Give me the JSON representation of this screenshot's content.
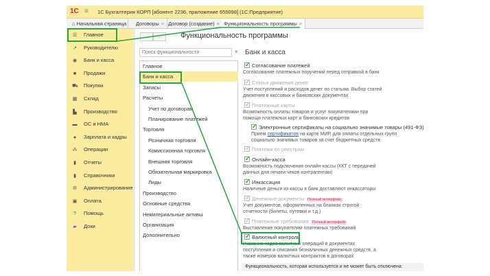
{
  "app": {
    "title": "1С Бухгалтерия КОРП [абонент 2236, приложение 655098]  (1С:Предприятие)",
    "logo": "1С"
  },
  "tabs": [
    {
      "label": "Начальная страница"
    },
    {
      "label": "Договоры"
    },
    {
      "label": "Договор (создание)"
    },
    {
      "label": "Функциональность программы"
    }
  ],
  "sidebar": {
    "items": [
      {
        "label": "Главное",
        "icon": "menu-icon"
      },
      {
        "label": "Руководителю",
        "icon": "chart-icon"
      },
      {
        "label": "Банк и касса",
        "icon": "bank-icon"
      },
      {
        "label": "Продажи",
        "icon": "bag-icon"
      },
      {
        "label": "Покупки",
        "icon": "cart-icon"
      },
      {
        "label": "Склад",
        "icon": "warehouse-icon"
      },
      {
        "label": "Производство",
        "icon": "factory-icon"
      },
      {
        "label": "ОС и НМА",
        "icon": "truck-icon"
      },
      {
        "label": "Зарплата и кадры",
        "icon": "person-icon"
      },
      {
        "label": "Операции",
        "icon": "operations-icon"
      },
      {
        "label": "Отчеты",
        "icon": "report-icon"
      },
      {
        "label": "Справочники",
        "icon": "book-icon"
      },
      {
        "label": "Администрирование",
        "icon": "gear-icon"
      },
      {
        "label": "Оплата",
        "icon": "wallet-icon"
      },
      {
        "label": "Помощь",
        "icon": "help-icon"
      },
      {
        "label": "Доки",
        "icon": "docs-icon"
      }
    ]
  },
  "form": {
    "title": "Функциональность программы",
    "search_placeholder": "Поиск функциональности",
    "search_clear": "×"
  },
  "tree": [
    "Главное",
    "Банк и касса",
    "Запасы",
    "Расчеты",
    "Учет по договорам",
    "Планирование платежей",
    "Торговля",
    "Розничная торговля",
    "Комиссионная торговля",
    "Внешняя торговля",
    "Обязательная маркировка",
    "Лиды",
    "Производство",
    "Основные средства",
    "Нематериальные активы",
    "Организация",
    "Дополнительно"
  ],
  "section": {
    "title": "Банк и касса",
    "options": [
      {
        "label": "Согласование платежей",
        "desc": "Согласование платежных поручений перед отправкой в банк"
      },
      {
        "label": "Статьи движения денег",
        "desc": "Учет поступлений и расходов денег по статьям. Выбор статей движения в кассовых и банковских документах"
      },
      {
        "label": "Платежные карты",
        "desc": "Возможность оплаты товаров и услуг покупателями при помощи платежных карт и банковских кредитов"
      },
      {
        "label": "Электронные сертификаты на социально значимые товары (491-ФЗ)",
        "desc_pre": "Прием ",
        "desc_link": "сертификатов",
        "desc_post": " на карте МИР, для оплаты отдельных групп социально значимых товаров за счет бюджетных средств"
      },
      {
        "label": "Платежи по реестрам"
      },
      {
        "label": "Онлайн-касса",
        "desc": "Возможность подключения онлайн-кассы (ККТ с передачей данных для печати чеков контрагентам)"
      },
      {
        "label": "Инкассация",
        "desc": "Наличные деньги из кассы в банк доставляют инкассаторы"
      },
      {
        "label": "Денежные документы",
        "badge": "Полный интерфейс",
        "desc": "Учет документов, оформленных на бланках строгой отчетности (билеты, путевки и т.д.)"
      },
      {
        "label": "Платежные требования",
        "badge": "Полный интерфейс",
        "desc": "Выставление покупателям платежных требований"
      },
      {
        "label": "Валютный контроль",
        "desc": "Указание кодов валютных операций в документах поступления и списания безналичных денежных средств, а также номеров валютных контрактов в договорах"
      }
    ],
    "footer": "Функциональность, которая используется и не может быть отключена:"
  },
  "colors": {
    "highlight": "#22a83a",
    "sidebar": "#fbeca0"
  }
}
